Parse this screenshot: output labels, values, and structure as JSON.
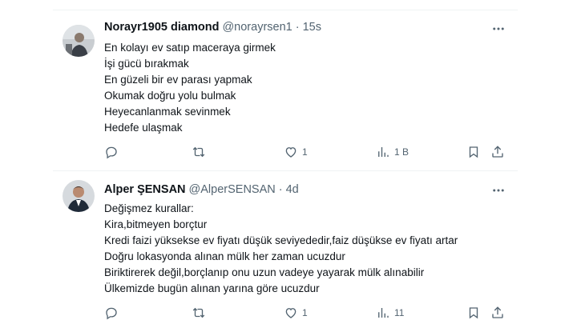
{
  "tweets": [
    {
      "display_name": "Norayr1905 diamond",
      "handle": "@norayrsen1",
      "time": "15s",
      "lines": [
        "En kolayı ev satıp maceraya girmek",
        "İşi gücü bırakmak",
        "En güzeli bir ev parası yapmak",
        "Okumak doğru yolu bulmak",
        "Heyecanlanmak sevinmek",
        "Hedefe ulaşmak"
      ],
      "actions": {
        "reply": "",
        "retweet": "",
        "like": "1",
        "views": "1 B"
      }
    },
    {
      "display_name": "Alper ŞENSAN",
      "handle": "@AlperSENSAN",
      "time": "4d",
      "lines": [
        "Değişmez kurallar:",
        "Kira,bitmeyen borçtur",
        "Kredi faizi yüksekse ev fiyatı düşük seviyededir,faiz düşükse ev fiyatı artar",
        "Doğru lokasyonda alınan mülk her zaman ucuzdur",
        "Biriktirerek değil,borçlanıp onu uzun vadeye yayarak mülk alınabilir",
        "Ülkemizde bugün alınan yarına göre ucuzdur"
      ],
      "actions": {
        "reply": "",
        "retweet": "",
        "like": "1",
        "views": "11"
      }
    }
  ],
  "separator": "·",
  "icons": [
    "reply-icon",
    "retweet-icon",
    "like-icon",
    "views-icon",
    "bookmark-icon",
    "share-icon",
    "more-icon"
  ],
  "colors": {
    "text": "#0f1419",
    "secondary": "#536471",
    "divider": "#eff3f4"
  }
}
